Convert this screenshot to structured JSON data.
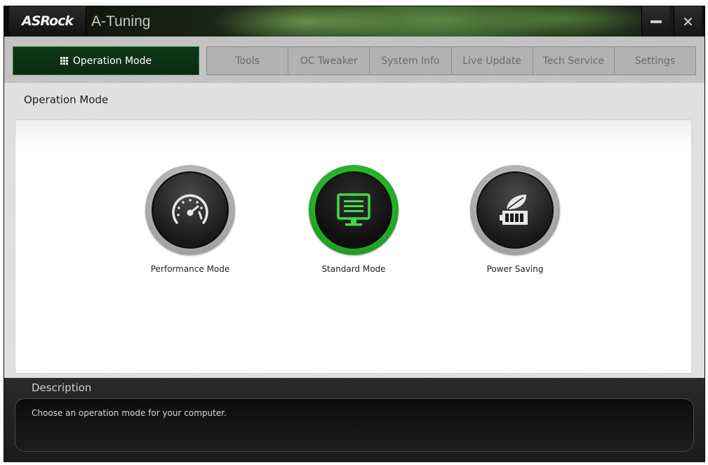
{
  "window": {
    "brand": "ASRock",
    "title": "A-Tuning",
    "minimize_icon": "minimize-icon",
    "close_icon": "close-icon"
  },
  "nav": {
    "active_tab": {
      "label": "Operation Mode",
      "icon": "grid-icon"
    },
    "tabs": [
      {
        "label": "Tools"
      },
      {
        "label": "OC Tweaker"
      },
      {
        "label": "System Info"
      },
      {
        "label": "Live Update"
      },
      {
        "label": "Tech Service"
      },
      {
        "label": "Settings"
      }
    ]
  },
  "main": {
    "section_title": "Operation Mode",
    "modes": [
      {
        "label": "Performance Mode",
        "icon": "speedometer-icon",
        "selected": false
      },
      {
        "label": "Standard Mode",
        "icon": "monitor-icon",
        "selected": true
      },
      {
        "label": "Power Saving",
        "icon": "leaf-battery-icon",
        "selected": false
      }
    ]
  },
  "description": {
    "title": "Description",
    "text": "Choose an operation mode for your computer."
  },
  "colors": {
    "accent_green": "#2fc035",
    "active_tab_bg": "#0e3a17",
    "icon_dark": "#1a1a1a"
  }
}
